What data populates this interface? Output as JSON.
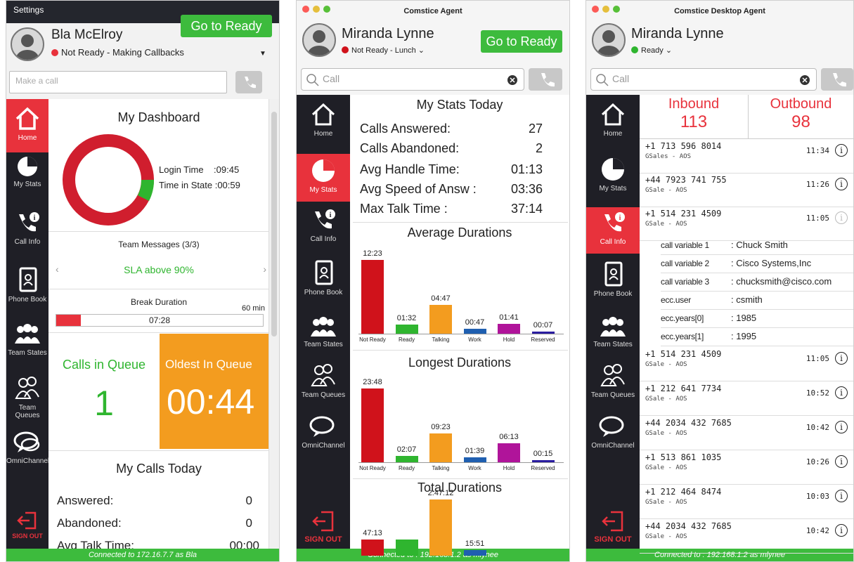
{
  "panel1": {
    "settings_label": "Settings",
    "agent_name": "Bla McElroy",
    "status_text": "Not Ready - Making Callbacks",
    "go_ready": "Go to Ready",
    "call_placeholder": "Make a call",
    "sidebar": [
      {
        "label": "Home",
        "icon": "home-icon"
      },
      {
        "label": "My Stats",
        "icon": "pie-chart-icon"
      },
      {
        "label": "Call Info",
        "icon": "phone-info-icon"
      },
      {
        "label": "Phone Book",
        "icon": "phone-book-icon"
      },
      {
        "label": "Team States",
        "icon": "team-icon"
      },
      {
        "label": "Team Queues",
        "icon": "team-queues-icon"
      },
      {
        "label": "OmniChannel",
        "icon": "chat-icon"
      }
    ],
    "signout": "SIGN OUT",
    "dashboard_title": "My Dashboard",
    "login_time": "Login Time    :09:45",
    "time_in_state": "Time in State :00:59",
    "team_messages": "Team Messages (3/3)",
    "sla_message": "SLA above 90%",
    "break_title": "Break Duration",
    "break_max": "60 min",
    "break_value": "07:28",
    "break_fill_fraction": 0.12,
    "calls_in_queue_label": "Calls in Queue",
    "calls_in_queue_value": "1",
    "oldest_label": "Oldest In Queue",
    "oldest_value": "00:44",
    "my_calls_title": "My Calls Today",
    "answered_label": "Answered:",
    "answered_value": "0",
    "abandoned_label": "Abandoned:",
    "abandoned_value": "0",
    "avg_talk_label": "Avg Talk Time:",
    "avg_talk_value": "00:00",
    "footer": "Connected to 172.16.7.7 as Bla"
  },
  "panel2": {
    "window_title": "Comstice Agent",
    "agent_name": "Miranda Lynne",
    "status_text": "Not Ready - Lunch",
    "go_ready": "Go to Ready",
    "call_placeholder": "Call",
    "sidebar": [
      {
        "label": "Home"
      },
      {
        "label": "My Stats"
      },
      {
        "label": "Call Info"
      },
      {
        "label": "Phone Book"
      },
      {
        "label": "Team States"
      },
      {
        "label": "Team Queues"
      },
      {
        "label": "OmniChannel"
      }
    ],
    "signout": "SIGN OUT",
    "stats_title": "My Stats Today",
    "stats": [
      {
        "label": "Calls Answered:",
        "value": "27"
      },
      {
        "label": "Calls Abandoned:",
        "value": "2"
      },
      {
        "label": "Avg Handle Time:",
        "value": "01:13"
      },
      {
        "label": "Avg Speed of Answ :",
        "value": "03:36"
      },
      {
        "label": "Max Talk Time :",
        "value": "37:14"
      }
    ],
    "avg_title": "Average Durations",
    "longest_title": "Longest Durations",
    "total_title": "Total Durations",
    "footer": "Connected to : 192.168.1.2 as mlynee"
  },
  "panel3": {
    "window_title": "Comstice Desktop Agent",
    "agent_name": "Miranda Lynne",
    "status_text": "Ready",
    "call_placeholder": "Call",
    "sidebar": [
      {
        "label": "Home"
      },
      {
        "label": "My Stats"
      },
      {
        "label": "Call Info"
      },
      {
        "label": "Phone Book"
      },
      {
        "label": "Team States"
      },
      {
        "label": "Team Queues"
      },
      {
        "label": "OmniChannel"
      }
    ],
    "signout": "SIGN OUT",
    "inbound_label": "Inbound",
    "inbound_value": "113",
    "outbound_label": "Outbound",
    "outbound_value": "98",
    "calls_top": [
      {
        "number": "+1 713 596 8014",
        "sub": "GSales - AOS",
        "time": "11:34"
      },
      {
        "number": "+44 7923 741 755",
        "sub": "GSale - AOS",
        "time": "11:26"
      },
      {
        "number": "+1 514 231 4509",
        "sub": "GSale - AOS",
        "time": "11:05"
      }
    ],
    "variables": [
      {
        "key": "call variable 1",
        "value": ": Chuck Smith"
      },
      {
        "key": "call variable 2",
        "value": ": Cisco Systems,Inc"
      },
      {
        "key": "call variable 3",
        "value": ": chucksmith@cisco.com"
      },
      {
        "key": "ecc.user",
        "value": ": csmith"
      },
      {
        "key": "ecc.years[0]",
        "value": ": 1985"
      },
      {
        "key": "ecc.years[1]",
        "value": ": 1995"
      }
    ],
    "calls_bottom": [
      {
        "number": "+1 514 231 4509",
        "sub": "GSale - AOS",
        "time": "11:05"
      },
      {
        "number": "+1 212 641 7734",
        "sub": "GSale - AOS",
        "time": "10:52"
      },
      {
        "number": "+44 2034 432 7685",
        "sub": "GSale - AOS",
        "time": "10:42"
      },
      {
        "number": "+1 513 861 1035",
        "sub": "GSale - AOS",
        "time": "10:26"
      },
      {
        "number": "+1 212 464 8474",
        "sub": "GSale - AOS",
        "time": "10:03"
      },
      {
        "number": "+44 2034 432 7685",
        "sub": "GSale - AOS",
        "time": "10:42"
      }
    ],
    "footer": "Connected to : 192.168.1.2 as mlynee"
  },
  "chart_data": [
    {
      "type": "bar",
      "title": "Average Durations",
      "categories": [
        "Not Ready",
        "Ready",
        "Talking",
        "Work",
        "Hold",
        "Reserved"
      ],
      "values": [
        743,
        92,
        287,
        47,
        101,
        7
      ],
      "labels": [
        "12:23",
        "01:32",
        "04:47",
        "00:47",
        "01:41",
        "00:07"
      ],
      "colors": [
        "#d0121b",
        "#2fb52f",
        "#f39c1f",
        "#1f5fb0",
        "#b0149a",
        "#2a1da0"
      ]
    },
    {
      "type": "bar",
      "title": "Longest Durations",
      "categories": [
        "Not Ready",
        "Ready",
        "Talking",
        "Work",
        "Hold",
        "Reserved"
      ],
      "values": [
        1428,
        127,
        563,
        99,
        373,
        15
      ],
      "labels": [
        "23:48",
        "02:07",
        "09:23",
        "01:39",
        "06:13",
        "00:15"
      ],
      "colors": [
        "#d0121b",
        "#2fb52f",
        "#f39c1f",
        "#1f5fb0",
        "#b0149a",
        "#2a1da0"
      ]
    },
    {
      "type": "bar",
      "title": "Total Durations",
      "categories": [
        "Not Ready",
        "Ready",
        "Talking",
        "Work",
        "Hold",
        "Reserved"
      ],
      "values": [
        2833,
        2867,
        10032,
        951
      ],
      "labels": [
        "47:13",
        "",
        "2:47:12",
        "15:51"
      ],
      "colors": [
        "#d0121b",
        "#2fb52f",
        "#f39c1f",
        "#1f5fb0"
      ]
    }
  ],
  "colors": {
    "accent_red": "#e8323c",
    "ready_green": "#3dbb3d",
    "sidebar_dark": "#1f1f26",
    "queue_orange": "#f39c1f"
  }
}
